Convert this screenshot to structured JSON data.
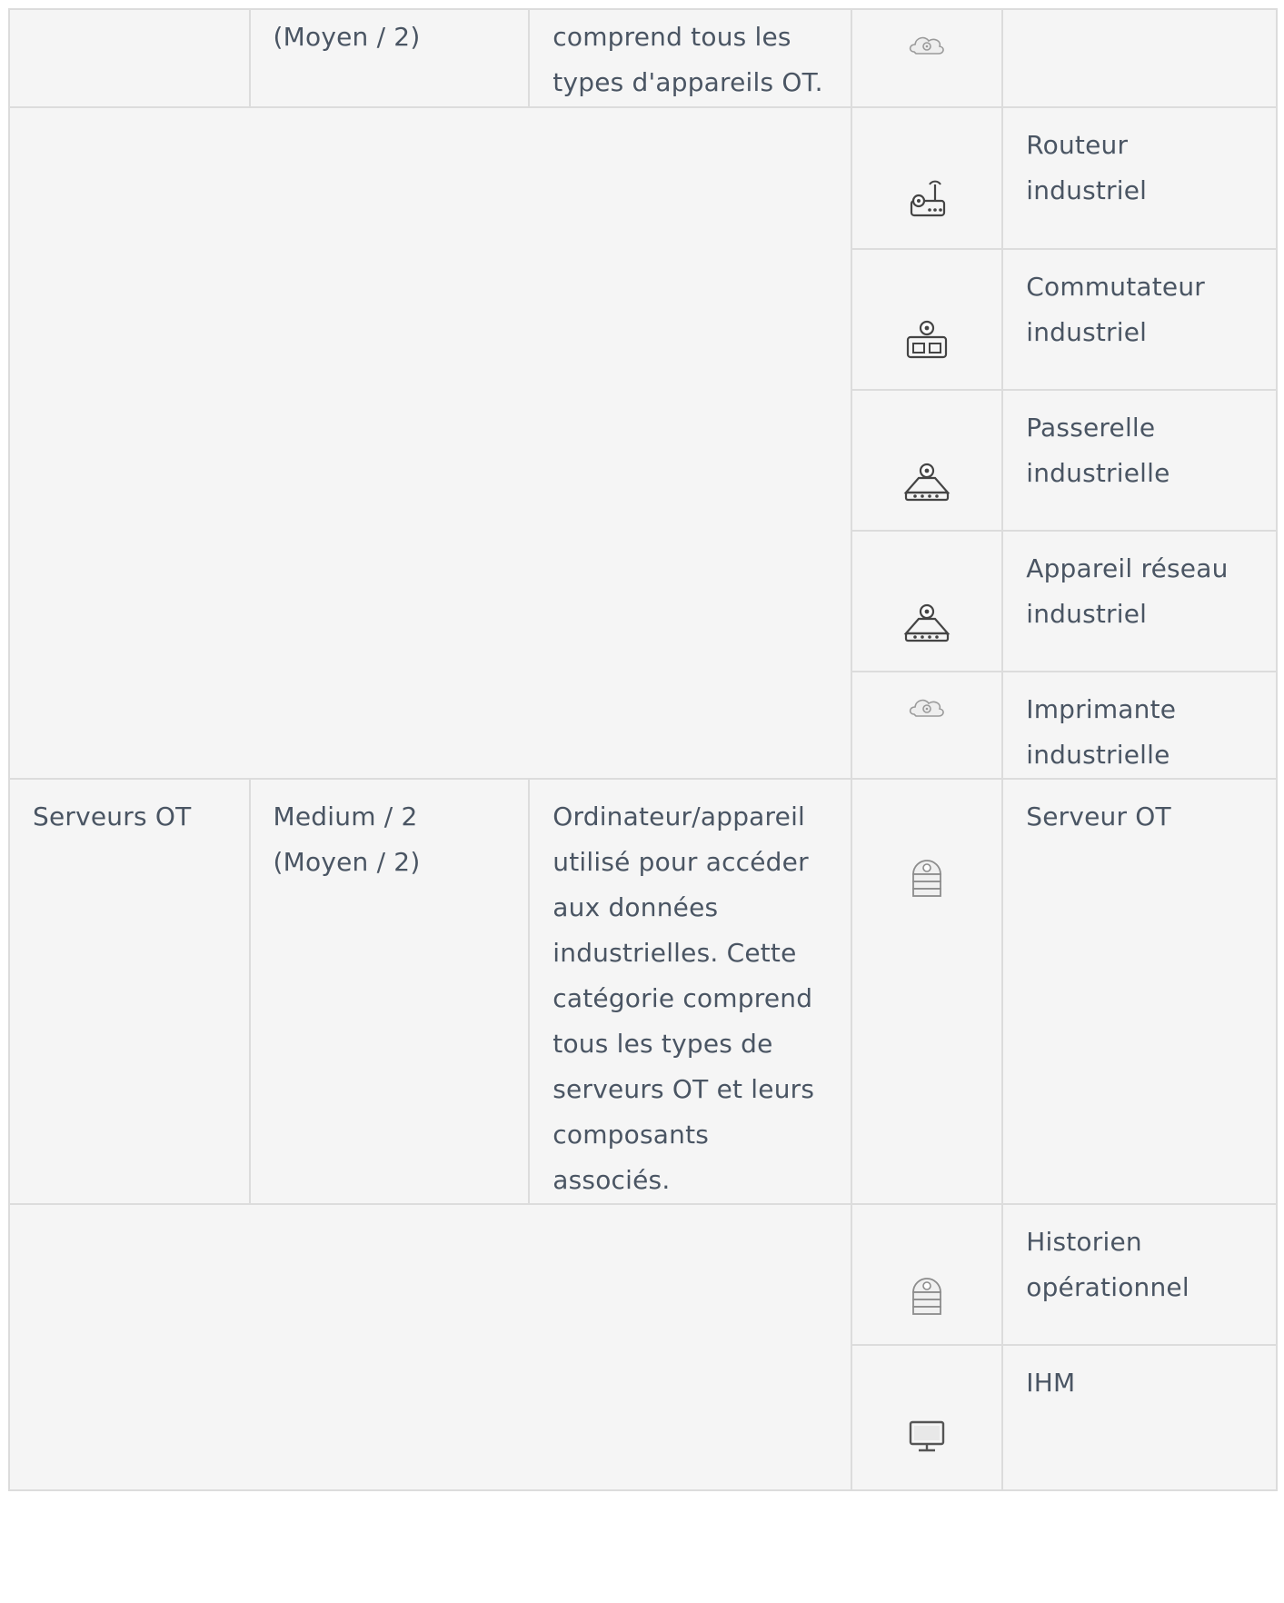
{
  "table": {
    "row_top": {
      "risk": "(Moyen / 2)",
      "description": "comprend tous les types d'appareils OT.",
      "icon": "industrial-cloud-icon"
    },
    "network_types": [
      {
        "label": "Routeur industriel",
        "icon": "industrial-router-icon"
      },
      {
        "label": "Commutateur industriel",
        "icon": "industrial-switch-icon"
      },
      {
        "label": "Passerelle industrielle",
        "icon": "industrial-gateway-icon"
      },
      {
        "label": "Appareil réseau industriel",
        "icon": "industrial-network-device-icon"
      },
      {
        "label": "Imprimante industrielle",
        "icon": "industrial-cloud-icon"
      }
    ],
    "servers": {
      "category": "Serveurs OT",
      "risk_line1": "Medium / 2",
      "risk_line2": "(Moyen / 2)",
      "description": "Ordinateur/appareil utilisé pour accéder aux données industrielles. Cette catégorie comprend tous les types de serveurs OT et leurs composants associés.",
      "first_type": {
        "label": "Serveur OT",
        "icon": "ot-server-icon"
      },
      "types": [
        {
          "label": "Historien opérationnel",
          "icon": "ot-server-icon"
        },
        {
          "label": "IHM",
          "icon": "monitor-icon"
        }
      ]
    }
  }
}
